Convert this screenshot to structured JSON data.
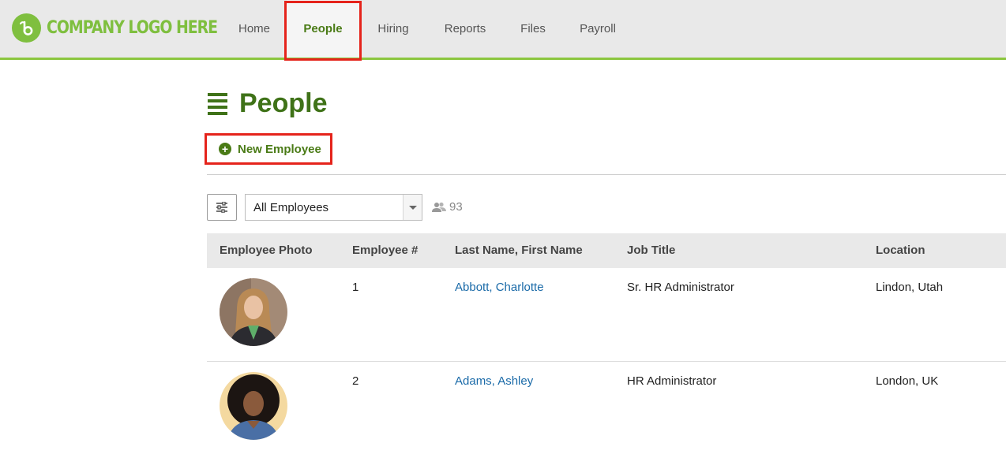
{
  "brand": {
    "logo_text": "COMPANY LOGO HERE",
    "accent": "#8cc63f",
    "primary": "#3f7218",
    "link": "#1a6aa8",
    "highlight": "#e5231b"
  },
  "nav": {
    "items": [
      {
        "label": "Home"
      },
      {
        "label": "People"
      },
      {
        "label": "Hiring"
      },
      {
        "label": "Reports"
      },
      {
        "label": "Files"
      },
      {
        "label": "Payroll"
      }
    ],
    "active": "People"
  },
  "page": {
    "title": "People",
    "new_employee_label": "New Employee"
  },
  "filter": {
    "selected": "All Employees",
    "employee_count": "93"
  },
  "table": {
    "headers": [
      "Employee Photo",
      "Employee #",
      "Last Name, First Name",
      "Job Title",
      "Location"
    ],
    "rows": [
      {
        "number": "1",
        "name": "Abbott, Charlotte",
        "job_title": "Sr. HR Administrator",
        "location": "Lindon, Utah"
      },
      {
        "number": "2",
        "name": "Adams, Ashley",
        "job_title": "HR Administrator",
        "location": "London, UK"
      }
    ]
  }
}
